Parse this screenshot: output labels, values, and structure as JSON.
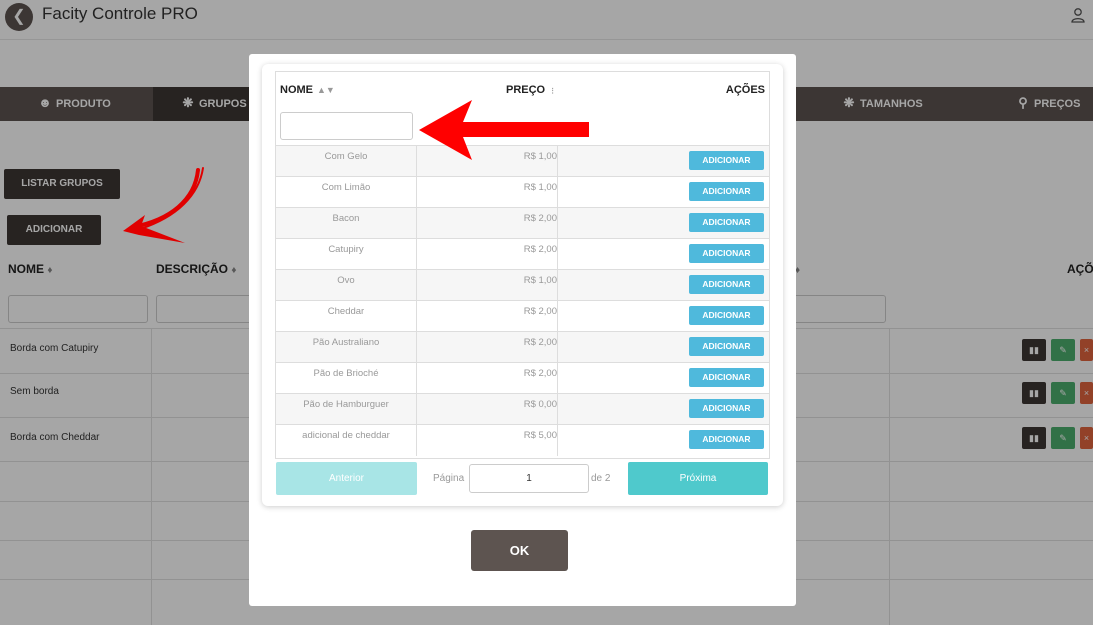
{
  "app": {
    "title": "Facity Controle PRO",
    "back_icon": "arrow-left-icon",
    "user_icon": "user-icon"
  },
  "nav": {
    "tabs": [
      {
        "label": "PRODUTO",
        "icon": "user-icon"
      },
      {
        "label": "GRUPOS",
        "icon": "grid-circle-icon",
        "active": true
      },
      {
        "label": "TAMANHOS",
        "icon": "grid-circle-icon"
      },
      {
        "label": "PREÇOS",
        "icon": "map-pin-icon"
      }
    ]
  },
  "page": {
    "list_groups_button": "LISTAR GRUPOS",
    "add_button": "ADICIONAR",
    "table": {
      "headers": {
        "name": "NOME",
        "description": "DESCRIÇÃO",
        "actions": "AÇÕ"
      },
      "rows": [
        {
          "name": "Borda com Catupiry"
        },
        {
          "name": "Sem borda"
        },
        {
          "name": "Borda com Cheddar"
        }
      ]
    }
  },
  "modal": {
    "headers": {
      "name": "NOME",
      "price": "PREÇO",
      "actions": "AÇÕES"
    },
    "rows": [
      {
        "name": "Com Gelo",
        "price": "R$ 1,00",
        "action": "ADICIONAR"
      },
      {
        "name": "Com Limão",
        "price": "R$ 1,00",
        "action": "ADICIONAR"
      },
      {
        "name": "Bacon",
        "price": "R$ 2,00",
        "action": "ADICIONAR"
      },
      {
        "name": "Catupiry",
        "price": "R$ 2,00",
        "action": "ADICIONAR"
      },
      {
        "name": "Ovo",
        "price": "R$ 1,00",
        "action": "ADICIONAR"
      },
      {
        "name": "Cheddar",
        "price": "R$ 2,00",
        "action": "ADICIONAR"
      },
      {
        "name": "Pão Australiano",
        "price": "R$ 2,00",
        "action": "ADICIONAR"
      },
      {
        "name": "Pão de Brioché",
        "price": "R$ 2,00",
        "action": "ADICIONAR"
      },
      {
        "name": "Pão de Hamburguer",
        "price": "R$ 0,00",
        "action": "ADICIONAR"
      },
      {
        "name": "adicional de cheddar",
        "price": "R$ 5,00",
        "action": "ADICIONAR"
      }
    ],
    "pagination": {
      "prev": "Anterior",
      "page_label": "Página",
      "page_value": "1",
      "of_label": "de 2",
      "next": "Próxima"
    },
    "ok_button": "OK"
  },
  "colors": {
    "nav_bg": "#5d5450",
    "accent_blue": "#4fb9dc",
    "accent_teal": "#4fc9cc",
    "annotation_red": "#ff0000"
  }
}
